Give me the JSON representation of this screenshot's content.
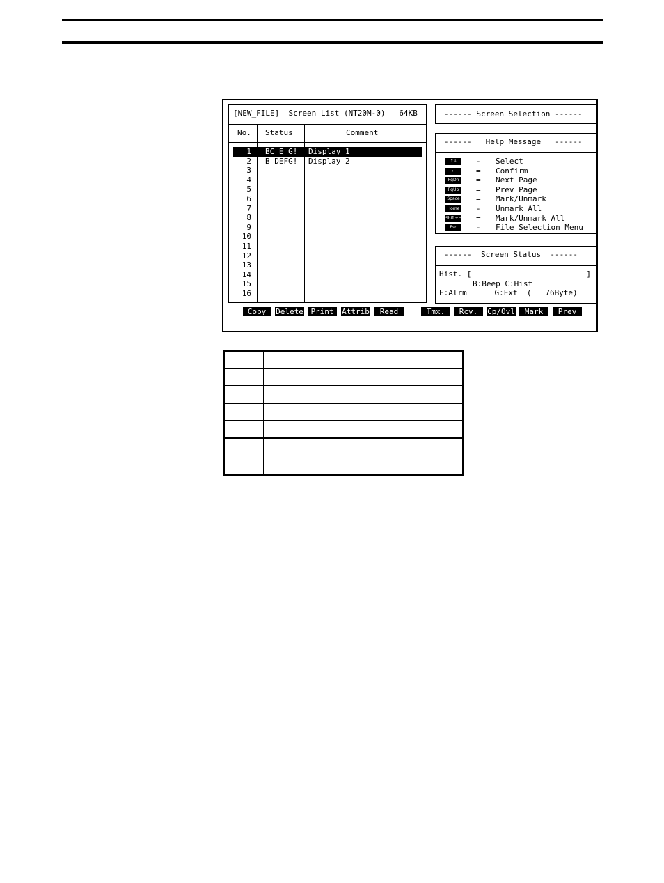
{
  "list": {
    "title": "[NEW_FILE]  Screen List (NT20M-0)   64KB",
    "headers": {
      "no": "No.",
      "status": "Status",
      "comment": "Comment"
    },
    "rows": [
      {
        "no": "1",
        "status": "BC E G!",
        "comment": "Display 1",
        "selected": true
      },
      {
        "no": "2",
        "status": "B DEFG!",
        "comment": "Display 2"
      },
      {
        "no": "3",
        "status": "",
        "comment": ""
      },
      {
        "no": "4",
        "status": "",
        "comment": ""
      },
      {
        "no": "5",
        "status": "",
        "comment": ""
      },
      {
        "no": "6",
        "status": "",
        "comment": ""
      },
      {
        "no": "7",
        "status": "",
        "comment": ""
      },
      {
        "no": "8",
        "status": "",
        "comment": ""
      },
      {
        "no": "9",
        "status": "",
        "comment": ""
      },
      {
        "no": "10",
        "status": "",
        "comment": ""
      },
      {
        "no": "11",
        "status": "",
        "comment": ""
      },
      {
        "no": "12",
        "status": "",
        "comment": ""
      },
      {
        "no": "13",
        "status": "",
        "comment": ""
      },
      {
        "no": "14",
        "status": "",
        "comment": ""
      },
      {
        "no": "15",
        "status": "",
        "comment": ""
      },
      {
        "no": "16",
        "status": "",
        "comment": ""
      }
    ]
  },
  "selection": {
    "title": "------ Screen Selection ------"
  },
  "help": {
    "title": "------   Help Message   ------",
    "items": [
      {
        "key": "↑↓",
        "icon": "arrow-keys-icon",
        "sym": "-",
        "desc": "Select"
      },
      {
        "key": "↵",
        "icon": "enter-key-icon",
        "sym": "=",
        "desc": "Confirm"
      },
      {
        "key": "PgDn",
        "icon": "pgdn-key-icon",
        "sym": "=",
        "desc": "Next Page"
      },
      {
        "key": "PgUp",
        "icon": "pgup-key-icon",
        "sym": "=",
        "desc": "Prev Page"
      },
      {
        "key": "Space",
        "icon": "space-key-icon",
        "sym": "=",
        "desc": "Mark/Unmark"
      },
      {
        "key": "Home",
        "icon": "home-key-icon",
        "sym": "-",
        "desc": "Unmark All"
      },
      {
        "key": "Shift+Home",
        "icon": "shift-home-key-icon",
        "sym": "=",
        "desc": "Mark/Unmark All"
      },
      {
        "key": "Esc",
        "icon": "esc-key-icon",
        "sym": "-",
        "desc": "File Selection Menu"
      }
    ]
  },
  "status": {
    "title": "------  Screen Status  ------",
    "line1": "Hist. [",
    "line1_close": "]",
    "line2": "B:Beep C:Hist",
    "line3": "E:Alrm      G:Ext  (   76Byte)"
  },
  "fkeys": [
    "Copy",
    "Delete",
    "Print",
    "Attrib",
    "Read",
    "Tmx.",
    "Rcv.",
    "Cp/Ovl",
    "Mark",
    "Prev"
  ]
}
